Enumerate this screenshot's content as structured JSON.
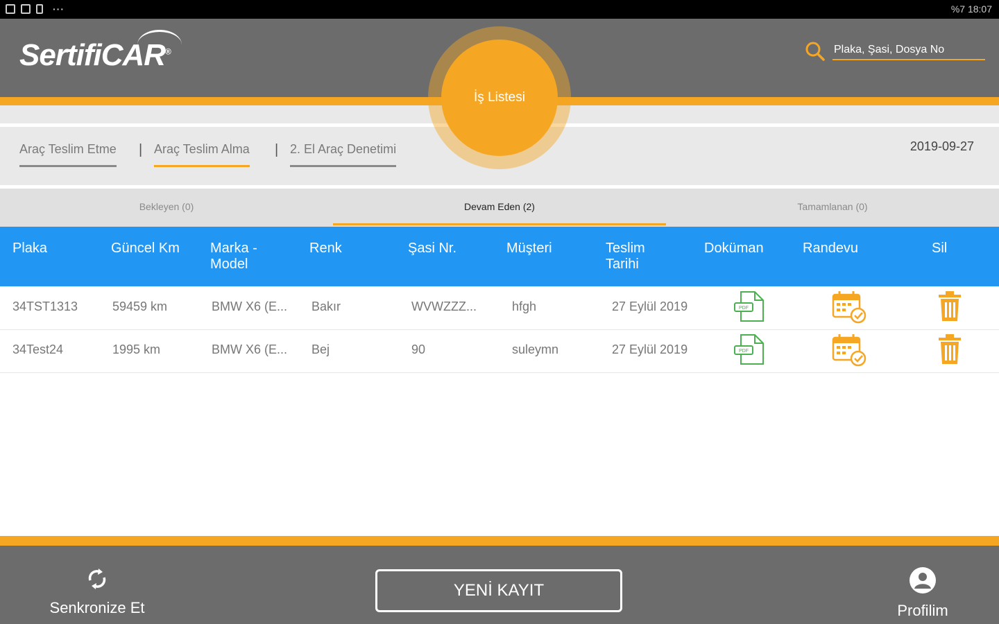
{
  "status_bar": {
    "right_text": "%7 18:07"
  },
  "header": {
    "logo": "SertifiCAR",
    "search_placeholder": "Plaka, Şasi, Dosya No",
    "center_button": "İş Listesi"
  },
  "subnav": {
    "tabs": [
      "Araç Teslim Etme",
      "Araç Teslim Alma",
      "2. El Araç Denetimi"
    ],
    "separator": "|",
    "date": "2019-09-27"
  },
  "work_tabs": [
    "Bekleyen (0)",
    "Devam Eden (2)",
    "Tamamlanan (0)"
  ],
  "table": {
    "headers": [
      "Plaka",
      "Güncel Km",
      "Marka - Model",
      "Renk",
      "Şasi Nr.",
      "Müşteri",
      "Teslim Tarihi",
      "Doküman",
      "Randevu",
      "Sil"
    ],
    "rows": [
      {
        "plaka": "34TST1313",
        "km": "59459 km",
        "model": "BMW X6 (E...",
        "renk": "Bakır",
        "sasi": "WVWZZZ...",
        "musteri": "hfgh",
        "tarih": "27 Eylül 2019"
      },
      {
        "plaka": "34Test24",
        "km": "1995 km",
        "model": "BMW X6 (E...",
        "renk": "Bej",
        "sasi": "90",
        "musteri": "suleymn",
        "tarih": "27 Eylül 2019"
      }
    ]
  },
  "footer": {
    "sync_label": "Senkronize Et",
    "new_record": "YENİ KAYIT",
    "profile_label": "Profilim"
  },
  "colors": {
    "accent": "#f5a623",
    "header_blue": "#2196f3",
    "bar_gray": "#6c6c6c",
    "pdf_green": "#4caf50"
  }
}
